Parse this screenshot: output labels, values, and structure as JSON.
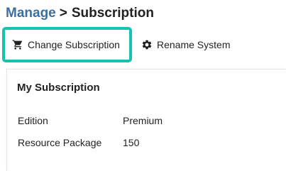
{
  "breadcrumb": {
    "parent": "Manage",
    "separator": ">",
    "current": "Subscription"
  },
  "toolbar": {
    "change_subscription_label": "Change Subscription",
    "change_subscription_icon": "cart-icon",
    "rename_system_label": "Rename System",
    "rename_system_icon": "gear-icon",
    "highlight_color": "#14c3b0"
  },
  "panel": {
    "title": "My Subscription",
    "rows": [
      {
        "label": "Edition",
        "value": "Premium"
      },
      {
        "label": "Resource Package",
        "value": "150"
      }
    ]
  },
  "colors": {
    "link": "#3d6e9f",
    "text": "#222222"
  }
}
